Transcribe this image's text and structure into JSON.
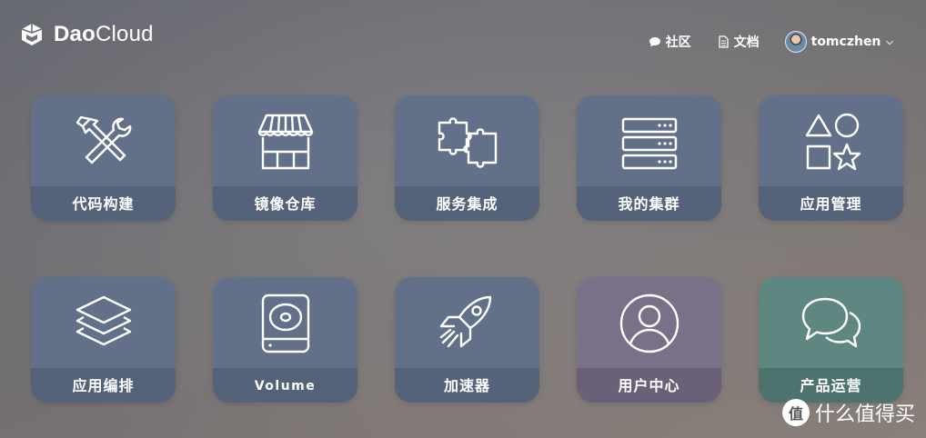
{
  "brand": {
    "name_bold": "Dao",
    "name_regular": "Cloud"
  },
  "nav": {
    "community_label": "社区",
    "docs_label": "文档",
    "user_name": "tomczhen"
  },
  "tiles": [
    {
      "label": "代码构建",
      "icon": "hammer-wrench-icon",
      "color": "#627189"
    },
    {
      "label": "镜像仓库",
      "icon": "storefront-icon",
      "color": "#627189"
    },
    {
      "label": "服务集成",
      "icon": "puzzle-icon",
      "color": "#627189"
    },
    {
      "label": "我的集群",
      "icon": "server-stack-icon",
      "color": "#627189"
    },
    {
      "label": "应用管理",
      "icon": "shapes-icon",
      "color": "#627189"
    },
    {
      "label": "应用编排",
      "icon": "layers-icon",
      "color": "#627189"
    },
    {
      "label": "Volume",
      "icon": "disk-drive-icon",
      "color": "#627189"
    },
    {
      "label": "加速器",
      "icon": "rocket-icon",
      "color": "#627189"
    },
    {
      "label": "用户中心",
      "icon": "user-circle-icon",
      "color": "#7a7189"
    },
    {
      "label": "产品运营",
      "icon": "chat-bubbles-icon",
      "color": "#5f8781"
    }
  ],
  "watermark": {
    "mark": "值",
    "text": "什么值得买"
  }
}
